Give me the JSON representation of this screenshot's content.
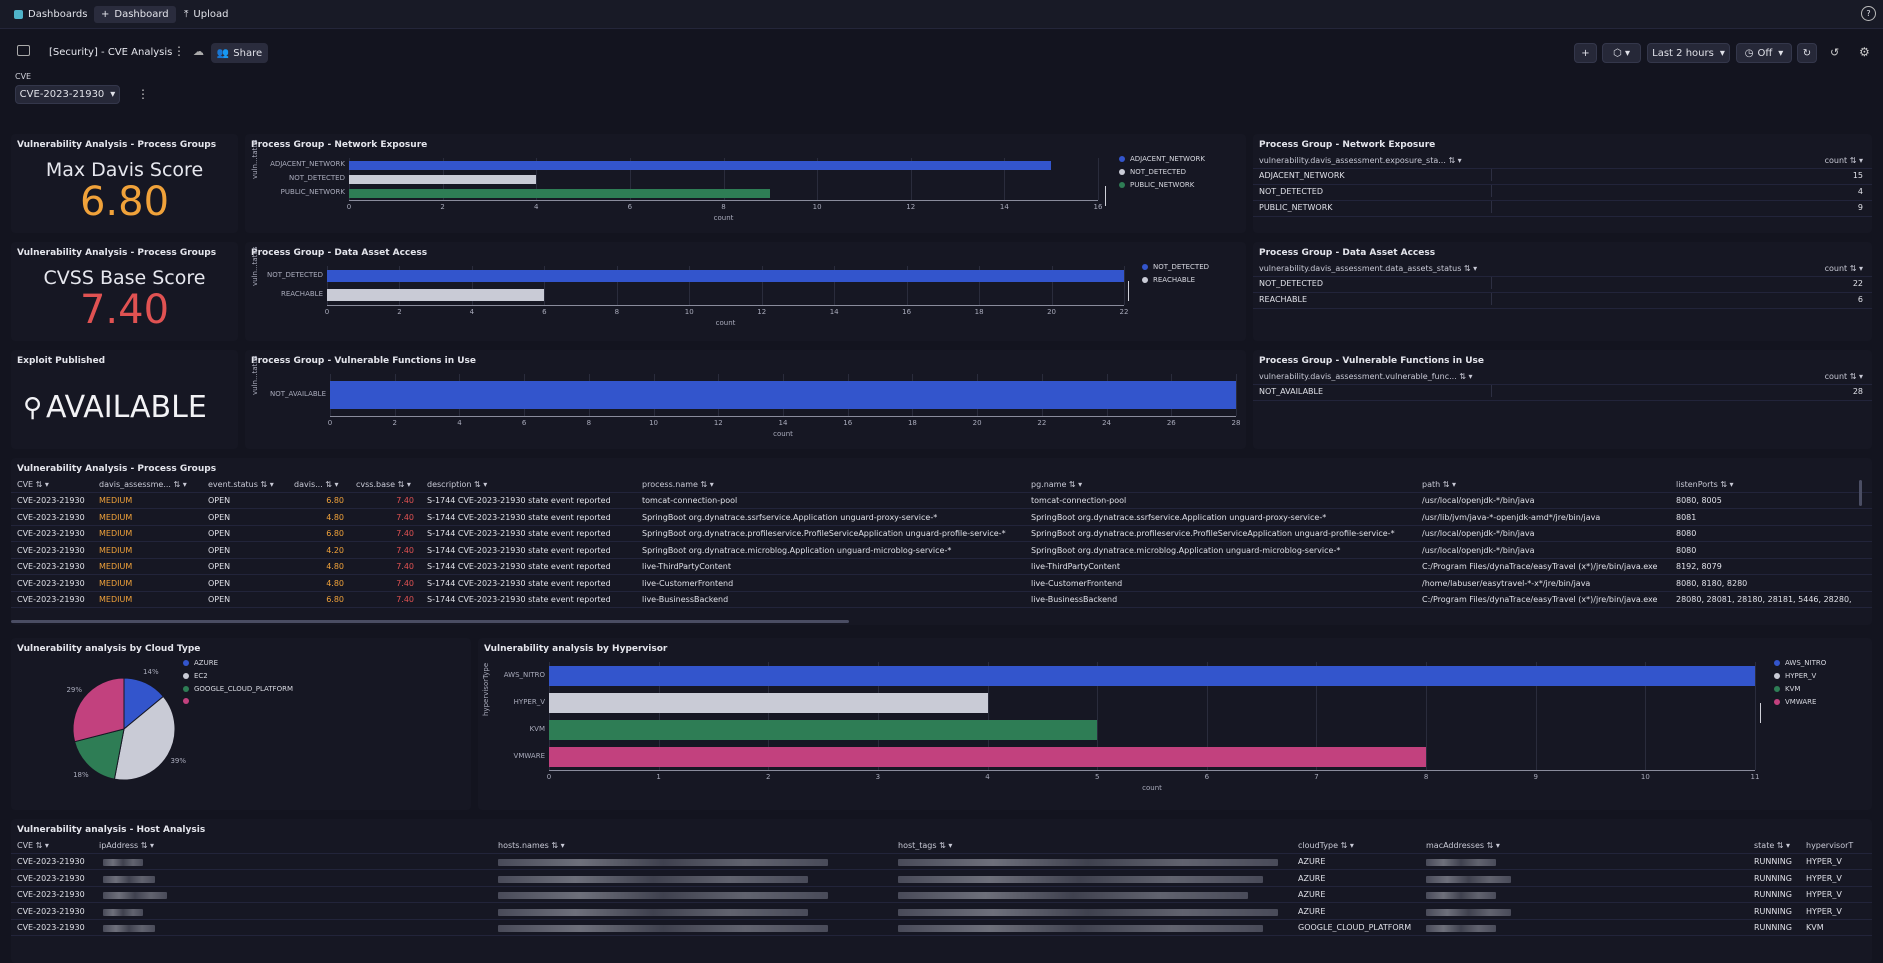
{
  "topbar": {
    "app": "Dashboards",
    "new_dashboard": "Dashboard",
    "upload": "Upload",
    "help": "?"
  },
  "dashbar": {
    "title": "[Security] - CVE Analysis",
    "share": "Share",
    "timeframe": "Last 2 hours",
    "refresh": "Off",
    "add": "+"
  },
  "filter": {
    "label": "CVE",
    "value": "CVE-2023-21930"
  },
  "tiles": {
    "davis": {
      "title": "Vulnerability Analysis - Process Groups",
      "label": "Max Davis Score",
      "value": "6.80",
      "color": "#f0a23a"
    },
    "cvss": {
      "title": "Vulnerability Analysis - Process Groups",
      "label": "CVSS Base Score",
      "value": "7.40",
      "color": "#e05252"
    },
    "exploit": {
      "title": "Exploit Published",
      "value": "AVAILABLE"
    }
  },
  "charts": {
    "network": {
      "title": "Process Group - Network Exposure",
      "ylabel": "vuln...tatus",
      "xlabel": "count",
      "ticks": [
        "0",
        "2",
        "4",
        "6",
        "8",
        "10",
        "12",
        "14",
        "16"
      ]
    },
    "asset": {
      "title": "Process Group - Data Asset Access",
      "ylabel": "vuln...tatus",
      "xlabel": "count",
      "ticks": [
        "0",
        "2",
        "4",
        "6",
        "8",
        "10",
        "12",
        "14",
        "16",
        "18",
        "20",
        "22"
      ]
    },
    "functions": {
      "title": "Process Group - Vulnerable Functions in Use",
      "ylabel": "vuln...tatus",
      "xlabel": "count",
      "ticks": [
        "0",
        "2",
        "4",
        "6",
        "8",
        "10",
        "12",
        "14",
        "16",
        "18",
        "20",
        "22",
        "24",
        "26",
        "28"
      ]
    },
    "cloud": {
      "title": "Vulnerability analysis by Cloud Type"
    },
    "hypervisor": {
      "title": "Vulnerability analysis by Hypervisor",
      "ylabel": "hypervisorType",
      "xlabel": "count",
      "ticks": [
        "0",
        "1",
        "2",
        "3",
        "4",
        "5",
        "6",
        "7",
        "8",
        "9",
        "10",
        "11"
      ]
    }
  },
  "chart_data": [
    {
      "type": "bar",
      "title": "Process Group - Network Exposure",
      "categories": [
        "ADJACENT_NETWORK",
        "NOT_DETECTED",
        "PUBLIC_NETWORK"
      ],
      "values": [
        15,
        4,
        9
      ],
      "xlim": [
        0,
        16
      ],
      "colors": [
        "#3355cc",
        "#c9cbd6",
        "#2e7d55"
      ]
    },
    {
      "type": "bar",
      "title": "Process Group - Data Asset Access",
      "categories": [
        "NOT_DETECTED",
        "REACHABLE"
      ],
      "values": [
        22,
        6
      ],
      "xlim": [
        0,
        22
      ],
      "colors": [
        "#3355cc",
        "#c9cbd6"
      ]
    },
    {
      "type": "bar",
      "title": "Process Group - Vulnerable Functions in Use",
      "categories": [
        "NOT_AVAILABLE"
      ],
      "values": [
        28
      ],
      "xlim": [
        0,
        28
      ],
      "colors": [
        "#3355cc"
      ]
    },
    {
      "type": "pie",
      "title": "Vulnerability analysis by Cloud Type",
      "categories": [
        "AZURE",
        "EC2",
        "GOOGLE_CLOUD_PLATFORM",
        ""
      ],
      "values": [
        14,
        39,
        18,
        29
      ],
      "colors": [
        "#3355cc",
        "#c9cbd6",
        "#2e7d55",
        "#c2417e"
      ]
    },
    {
      "type": "bar",
      "title": "Vulnerability analysis by Hypervisor",
      "categories": [
        "AWS_NITRO",
        "HYPER_V",
        "KVM",
        "VMWARE"
      ],
      "values": [
        11,
        4,
        5,
        8
      ],
      "xlim": [
        0,
        11
      ],
      "colors": [
        "#3355cc",
        "#c9cbd6",
        "#2e7d55",
        "#c2417e"
      ]
    }
  ],
  "tables": {
    "network": {
      "title": "Process Group - Network Exposure",
      "col1": "vulnerability.davis_assessment.exposure_sta...",
      "col2": "count",
      "rows": [
        [
          "ADJACENT_NETWORK",
          "15"
        ],
        [
          "NOT_DETECTED",
          "4"
        ],
        [
          "PUBLIC_NETWORK",
          "9"
        ]
      ]
    },
    "asset": {
      "title": "Process Group - Data Asset Access",
      "col1": "vulnerability.davis_assessment.data_assets_status",
      "col2": "count",
      "rows": [
        [
          "NOT_DETECTED",
          "22"
        ],
        [
          "REACHABLE",
          "6"
        ]
      ]
    },
    "functions": {
      "title": "Process Group - Vulnerable Functions in Use",
      "col1": "vulnerability.davis_assessment.vulnerable_func...",
      "col2": "count",
      "rows": [
        [
          "NOT_AVAILABLE",
          "28"
        ]
      ]
    },
    "process": {
      "title": "Vulnerability Analysis - Process Groups",
      "headers": [
        "CVE",
        "davis_assessme...",
        "event.status",
        "davis...",
        "cvss.base",
        "description",
        "process.name",
        "pg.name",
        "path",
        "listenPorts"
      ],
      "rows": [
        [
          "CVE-2023-21930",
          "MEDIUM",
          "OPEN",
          "6.80",
          "7.40",
          "S-1744 CVE-2023-21930 state event reported",
          "tomcat-connection-pool",
          "tomcat-connection-pool",
          "/usr/local/openjdk-*/bin/java",
          "8080, 8005"
        ],
        [
          "CVE-2023-21930",
          "MEDIUM",
          "OPEN",
          "4.80",
          "7.40",
          "S-1744 CVE-2023-21930 state event reported",
          "SpringBoot org.dynatrace.ssrfservice.Application unguard-proxy-service-*",
          "SpringBoot org.dynatrace.ssrfservice.Application unguard-proxy-service-*",
          "/usr/lib/jvm/java-*-openjdk-amd*/jre/bin/java",
          "8081"
        ],
        [
          "CVE-2023-21930",
          "MEDIUM",
          "OPEN",
          "6.80",
          "7.40",
          "S-1744 CVE-2023-21930 state event reported",
          "SpringBoot org.dynatrace.profileservice.ProfileServiceApplication unguard-profile-service-*",
          "SpringBoot org.dynatrace.profileservice.ProfileServiceApplication unguard-profile-service-*",
          "/usr/local/openjdk-*/bin/java",
          "8080"
        ],
        [
          "CVE-2023-21930",
          "MEDIUM",
          "OPEN",
          "4.20",
          "7.40",
          "S-1744 CVE-2023-21930 state event reported",
          "SpringBoot org.dynatrace.microblog.Application unguard-microblog-service-*",
          "SpringBoot org.dynatrace.microblog.Application unguard-microblog-service-*",
          "/usr/local/openjdk-*/bin/java",
          "8080"
        ],
        [
          "CVE-2023-21930",
          "MEDIUM",
          "OPEN",
          "4.80",
          "7.40",
          "S-1744 CVE-2023-21930 state event reported",
          "live-ThirdPartyContent",
          "live-ThirdPartyContent",
          "C:/Program Files/dynaTrace/easyTravel (x*)/jre/bin/java.exe",
          "8192, 8079"
        ],
        [
          "CVE-2023-21930",
          "MEDIUM",
          "OPEN",
          "4.80",
          "7.40",
          "S-1744 CVE-2023-21930 state event reported",
          "live-CustomerFrontend",
          "live-CustomerFrontend",
          "/home/labuser/easytravel-*-x*/jre/bin/java",
          "8080, 8180, 8280"
        ],
        [
          "CVE-2023-21930",
          "MEDIUM",
          "OPEN",
          "6.80",
          "7.40",
          "S-1744 CVE-2023-21930 state event reported",
          "live-BusinessBackend",
          "live-BusinessBackend",
          "C:/Program Files/dynaTrace/easyTravel (x*)/jre/bin/java.exe",
          "28080, 28081, 28180, 28181, 5446, 28280,"
        ]
      ]
    },
    "hosts": {
      "title": "Vulnerability analysis - Host Analysis",
      "headers": [
        "CVE",
        "ipAddress",
        "hosts.names",
        "host_tags",
        "cloudType",
        "macAddresses",
        "state",
        "hypervisorT"
      ],
      "rows": [
        [
          "CVE-2023-21930",
          "AZURE",
          "RUNNING",
          "HYPER_V"
        ],
        [
          "CVE-2023-21930",
          "AZURE",
          "RUNNING",
          "HYPER_V"
        ],
        [
          "CVE-2023-21930",
          "AZURE",
          "RUNNING",
          "HYPER_V"
        ],
        [
          "CVE-2023-21930",
          "AZURE",
          "RUNNING",
          "HYPER_V"
        ],
        [
          "CVE-2023-21930",
          "GOOGLE_CLOUD_PLATFORM",
          "RUNNING",
          "KVM"
        ]
      ]
    }
  }
}
